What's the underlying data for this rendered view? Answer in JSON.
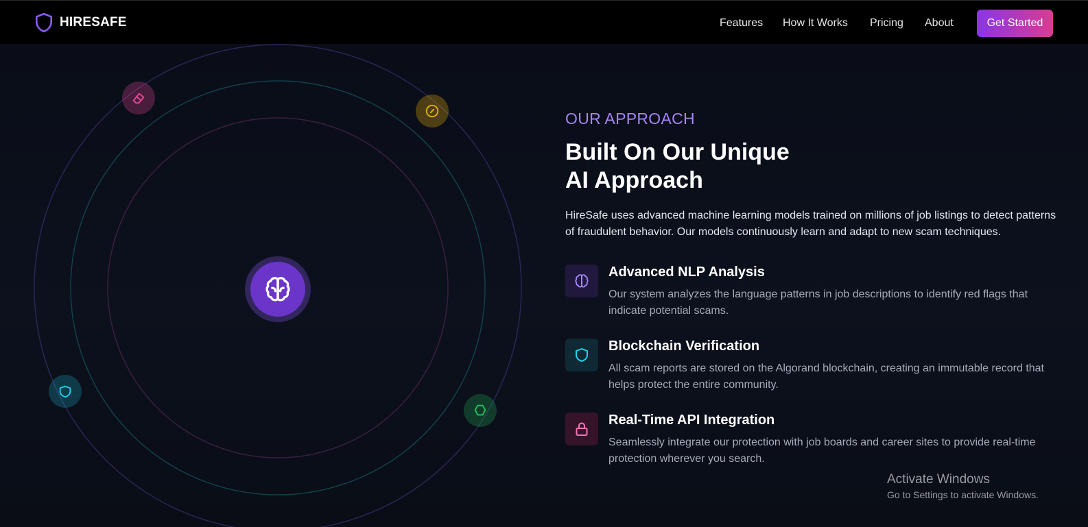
{
  "brand": {
    "name": "HIRESAFE",
    "logo_icon": "shield-icon"
  },
  "nav": {
    "items": [
      {
        "label": "Features"
      },
      {
        "label": "How It Works"
      },
      {
        "label": "Pricing"
      },
      {
        "label": "About"
      }
    ],
    "cta_label": "Get Started"
  },
  "section": {
    "eyebrow": "OUR APPROACH",
    "headline_line1": "Built On Our Unique",
    "headline_line2": "AI Approach",
    "intro": "HireSafe uses advanced machine learning models trained on millions of job listings to detect patterns of fraudulent behavior. Our models continuously learn and adapt to new scam techniques.",
    "features": [
      {
        "title": "Advanced NLP Analysis",
        "desc": "Our system analyzes the language patterns in job descriptions to identify red flags that indicate potential scams.",
        "icon": "brain-icon",
        "color": "#a78bfa"
      },
      {
        "title": "Blockchain Verification",
        "desc": "All scam reports are stored on the Algorand blockchain, creating an immutable record that helps protect the entire community.",
        "icon": "shield-icon",
        "color": "#22d3ee"
      },
      {
        "title": "Real-Time API Integration",
        "desc": "Seamlessly integrate our protection with job boards and career sites to provide real-time protection wherever you search.",
        "icon": "lock-icon",
        "color": "#f472b6"
      }
    ]
  },
  "orbit": {
    "center_icon": "brain-icon",
    "nodes": [
      {
        "icon": "eraser-icon",
        "color": "#ec4899"
      },
      {
        "icon": "compass-icon",
        "color": "#eab308"
      },
      {
        "icon": "shield-icon",
        "color": "#22d3ee"
      },
      {
        "icon": "hexagon-icon",
        "color": "#22c55e"
      }
    ]
  },
  "colors": {
    "accent": "#8b5cf6",
    "cta_start": "#8a35e8",
    "cta_end": "#d93c91",
    "background": "#0b0e17"
  },
  "watermark": {
    "title": "Activate Windows",
    "subtitle": "Go to Settings to activate Windows."
  }
}
